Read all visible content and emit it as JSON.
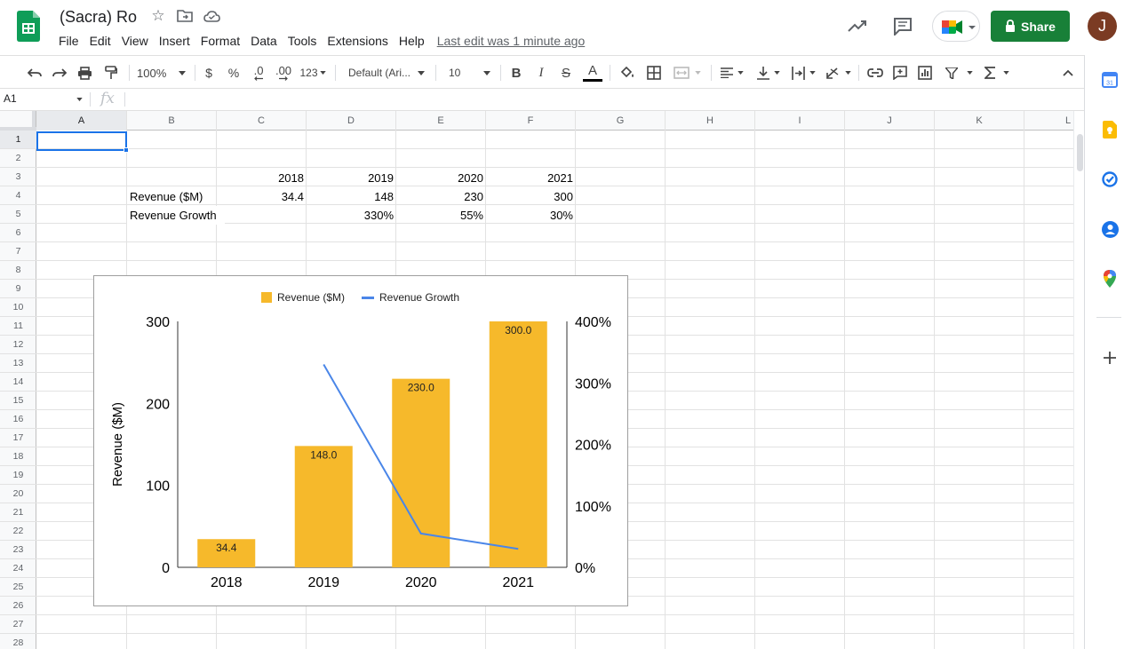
{
  "doc": {
    "title": "(Sacra) Ro",
    "last_edit": "Last edit was 1 minute ago"
  },
  "menu": [
    "File",
    "Edit",
    "View",
    "Insert",
    "Format",
    "Data",
    "Tools",
    "Extensions",
    "Help"
  ],
  "header": {
    "share_label": "Share",
    "avatar_letter": "J"
  },
  "toolbar": {
    "zoom": "100%",
    "currency": "$",
    "percent": "%",
    "dec_decrease": ".0",
    "dec_increase": ".00",
    "number_format": "123",
    "font": "Default (Ari...",
    "font_size": "10",
    "bold": "B",
    "italic": "I",
    "strike": "S",
    "text_color_letter": "A"
  },
  "formula_bar": {
    "cell_ref": "A1",
    "fx": "fx"
  },
  "columns": [
    "A",
    "B",
    "C",
    "D",
    "E",
    "F",
    "G",
    "H",
    "I",
    "J",
    "K",
    "L"
  ],
  "rows": [
    "1",
    "2",
    "3",
    "4",
    "5",
    "6",
    "7",
    "8",
    "9",
    "10",
    "11",
    "12",
    "13",
    "14",
    "15",
    "16",
    "17",
    "18",
    "19",
    "20",
    "21",
    "22",
    "23",
    "24",
    "25",
    "26",
    "27",
    "28"
  ],
  "cells": {
    "C3": "2018",
    "D3": "2019",
    "E3": "2020",
    "F3": "2021",
    "B4": "Revenue ($M)",
    "C4": "34.4",
    "D4": "148",
    "E4": "230",
    "F4": "300",
    "B5": "Revenue Growth",
    "D5": "330%",
    "E5": "55%",
    "F5": "30%"
  },
  "chart_data": {
    "type": "bar",
    "categories": [
      "2018",
      "2019",
      "2020",
      "2021"
    ],
    "series": [
      {
        "name": "Revenue ($M)",
        "type": "bar",
        "axis": "left",
        "values": [
          34.4,
          148,
          230,
          300
        ],
        "data_labels": [
          "34.4",
          "148.0",
          "230.0",
          "300.0"
        ],
        "color": "#f6b92b"
      },
      {
        "name": "Revenue Growth",
        "type": "line",
        "axis": "right",
        "values": [
          null,
          3.3,
          0.55,
          0.3
        ],
        "color": "#4a86e8"
      }
    ],
    "ylabel": "Revenue ($M)",
    "ylim": [
      0,
      300
    ],
    "yticks": [
      "0",
      "100",
      "200",
      "300"
    ],
    "y2lim": [
      0,
      4
    ],
    "y2ticks": [
      "0%",
      "100%",
      "200%",
      "300%",
      "400%"
    ],
    "legend": "top",
    "grid": false
  },
  "colors": {
    "accent": "#1a73e8",
    "share": "#188038",
    "bar": "#f6b92b",
    "line": "#4a86e8"
  },
  "icons": [
    "sheets-logo-icon",
    "star-icon",
    "move-folder-icon",
    "cloud-icon",
    "trend-icon",
    "comment-icon",
    "meet-icon",
    "share-lock-icon",
    "undo-icon",
    "redo-icon",
    "print-icon",
    "paint-format-icon",
    "fill-color-icon",
    "borders-icon",
    "merge-icon",
    "align-icon",
    "valign-icon",
    "wrap-icon",
    "rotate-icon",
    "link-icon",
    "add-comment-icon",
    "insert-chart-icon",
    "filter-icon",
    "functions-icon",
    "collapse-icon",
    "calendar-icon",
    "keep-icon",
    "tasks-icon",
    "contacts-icon",
    "maps-icon",
    "add-icon"
  ]
}
